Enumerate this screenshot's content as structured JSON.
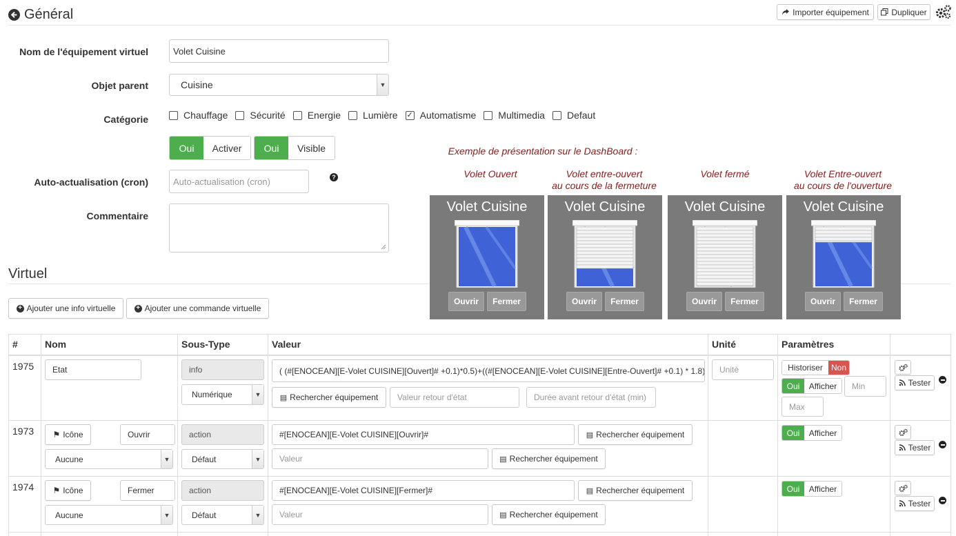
{
  "header": {
    "title": "Général",
    "import_label": "Importer équipement",
    "duplicate_label": "Dupliquer"
  },
  "form": {
    "name_label": "Nom de l'équipement virtuel",
    "name_value": "Volet Cuisine",
    "parent_label": "Objet parent",
    "parent_value": "Cuisine",
    "category_label": "Catégorie",
    "categories": [
      {
        "label": "Chauffage",
        "checked": false
      },
      {
        "label": "Sécurité",
        "checked": false
      },
      {
        "label": "Energie",
        "checked": false
      },
      {
        "label": "Lumière",
        "checked": false
      },
      {
        "label": "Automatisme",
        "checked": true
      },
      {
        "label": "Multimedia",
        "checked": false
      },
      {
        "label": "Defaut",
        "checked": false
      }
    ],
    "activate_on": "Oui",
    "activate_label": "Activer",
    "visible_on": "Oui",
    "visible_label": "Visible",
    "cron_label": "Auto-actualisation (cron)",
    "cron_placeholder": "Auto-actualisation (cron)",
    "help_icon": "?",
    "comment_label": "Commentaire"
  },
  "example": {
    "caption": "Exemple de présentation sur le DashBoard :",
    "widgets": [
      {
        "caption1": "Volet Ouvert",
        "caption2": "",
        "title": "Volet Cuisine",
        "open_label": "Ouvrir",
        "close_label": "Fermer",
        "closed_fraction": 0
      },
      {
        "caption1": "Volet entre-ouvert",
        "caption2": "au cours de la fermeture",
        "title": "Volet Cuisine",
        "open_label": "Ouvrir",
        "close_label": "Fermer",
        "closed_fraction": 0.7
      },
      {
        "caption1": "Volet fermé",
        "caption2": "",
        "title": "Volet Cuisine",
        "open_label": "Ouvrir",
        "close_label": "Fermer",
        "closed_fraction": 1
      },
      {
        "caption1": "Volet Entre-ouvert",
        "caption2": "au cours de l'ouverture",
        "title": "Volet Cuisine",
        "open_label": "Ouvrir",
        "close_label": "Fermer",
        "closed_fraction": 0.25
      }
    ]
  },
  "virtual": {
    "title": "Virtuel",
    "add_info_label": "Ajouter une info virtuelle",
    "add_command_label": "Ajouter une commande virtuelle"
  },
  "table": {
    "headers": {
      "id": "#",
      "name": "Nom",
      "subtype": "Sous-Type",
      "value": "Valeur",
      "unit": "Unité",
      "params": "Paramètres"
    },
    "rows": [
      {
        "id": "1975",
        "name": "Etat",
        "type": "info",
        "subtype": "Numérique",
        "value": "( (#[ENOCEAN][E-Volet CUISINE][Ouvert]# +0.1)*0.5)+((#[ENOCEAN][E-Volet CUISINE][Entre-Ouvert]# +0.1) * 1.8)",
        "search_label": "Rechercher équipement",
        "return_value_placeholder": "Valeur retour d'état",
        "return_delay_placeholder": "Durée avant retour d'état (min)",
        "unit_placeholder": "Unité",
        "historize_label": "Historiser",
        "historize_value": "Non",
        "show_on": "Oui",
        "show_label": "Afficher",
        "min_placeholder": "Min",
        "max_placeholder": "Max",
        "test_label": "Tester"
      },
      {
        "id": "1973",
        "icon_label": "Icône",
        "name": "Ouvrir",
        "type": "action",
        "subtype": "Défaut",
        "icon_select": "Aucune",
        "value": "#[ENOCEAN][E-Volet CUISINE][Ouvrir]#",
        "search_label": "Rechercher équipement",
        "value_placeholder": "Valeur",
        "show_on": "Oui",
        "show_label": "Afficher",
        "test_label": "Tester"
      },
      {
        "id": "1974",
        "icon_label": "Icône",
        "name": "Fermer",
        "type": "action",
        "subtype": "Défaut",
        "icon_select": "Aucune",
        "value": "#[ENOCEAN][E-Volet CUISINE][Fermer]#",
        "search_label": "Rechercher équipement",
        "value_placeholder": "Valeur",
        "show_on": "Oui",
        "show_label": "Afficher",
        "test_label": "Tester"
      }
    ]
  },
  "colors": {
    "green": "#4cae4c",
    "red": "#d9534f",
    "dark_red": "#8b1a1a",
    "widget_bg": "#7a7a7a"
  }
}
